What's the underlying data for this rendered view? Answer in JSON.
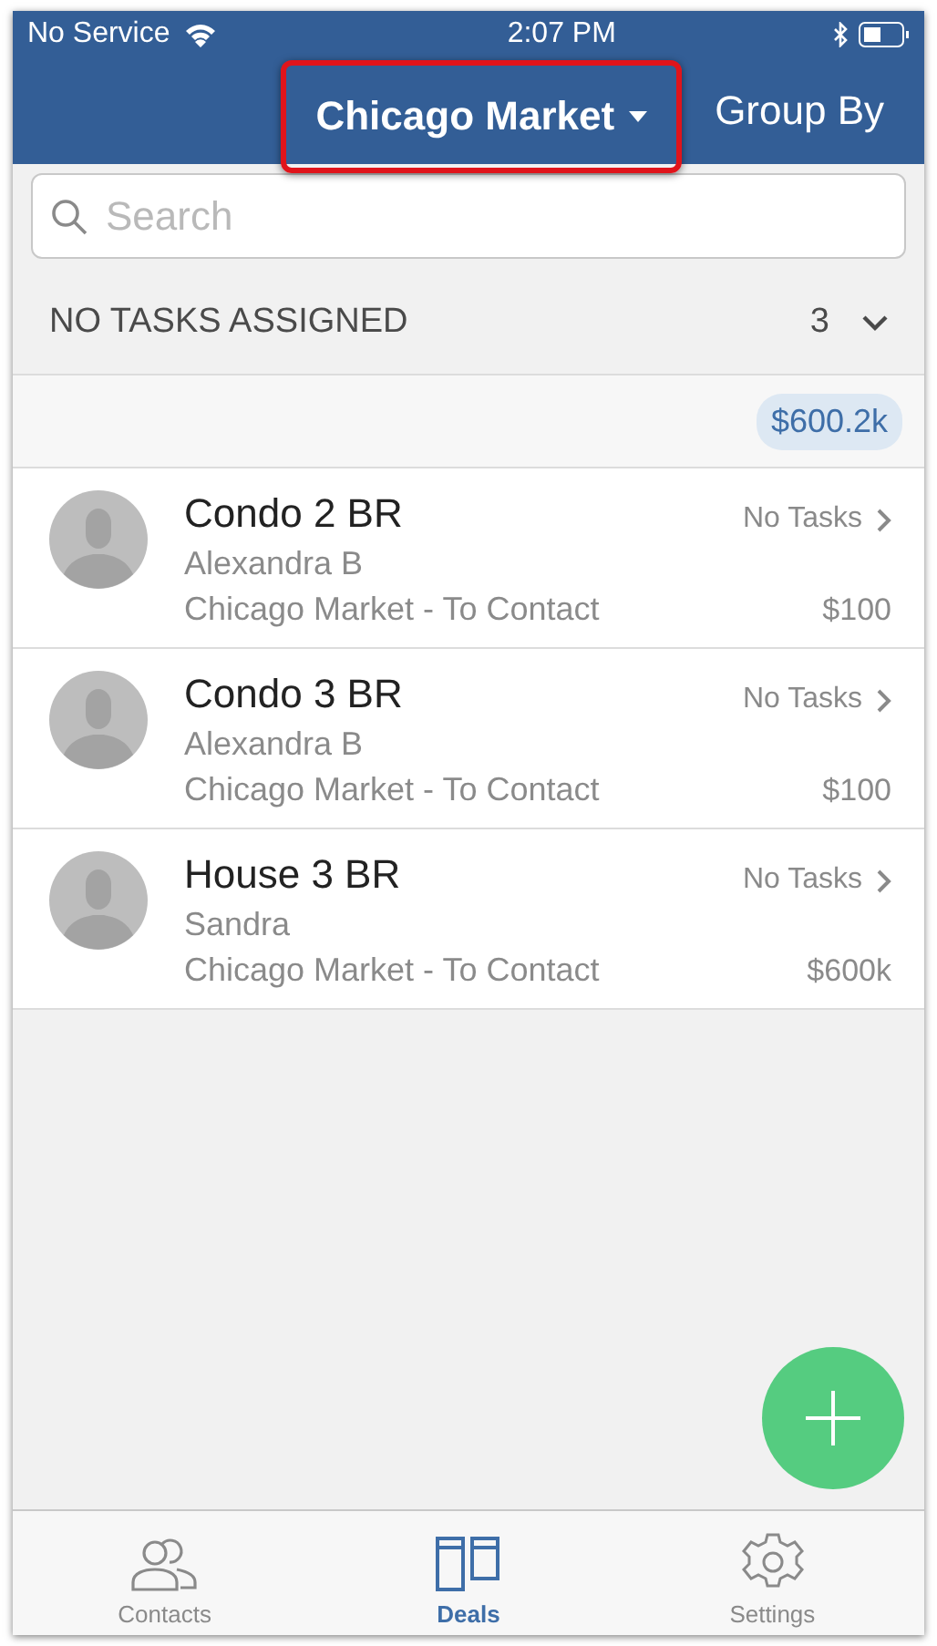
{
  "status_bar": {
    "carrier": "No Service",
    "time": "2:07 PM"
  },
  "nav": {
    "market": {
      "label": "Chicago Market",
      "highlighted": true
    },
    "group_by": "Group By"
  },
  "search": {
    "placeholder": "Search"
  },
  "section": {
    "title": "NO TASKS ASSIGNED",
    "count": "3",
    "expanded": true
  },
  "total": "$600.2k",
  "deals": [
    {
      "title": "Condo 2 BR",
      "contact": "Alexandra B",
      "stage": "Chicago Market - To Contact",
      "tasks": "No Tasks",
      "amount": "$100"
    },
    {
      "title": "Condo 3 BR",
      "contact": "Alexandra B",
      "stage": "Chicago Market - To Contact",
      "tasks": "No Tasks",
      "amount": "$100"
    },
    {
      "title": "House 3 BR",
      "contact": "Sandra",
      "stage": "Chicago Market - To Contact",
      "tasks": "No Tasks",
      "amount": "$600k"
    }
  ],
  "tabs": [
    {
      "kind": "contacts",
      "label": "Contacts",
      "selected": false
    },
    {
      "kind": "deals",
      "label": "Deals",
      "selected": true
    },
    {
      "kind": "settings",
      "label": "Settings",
      "selected": false
    }
  ]
}
